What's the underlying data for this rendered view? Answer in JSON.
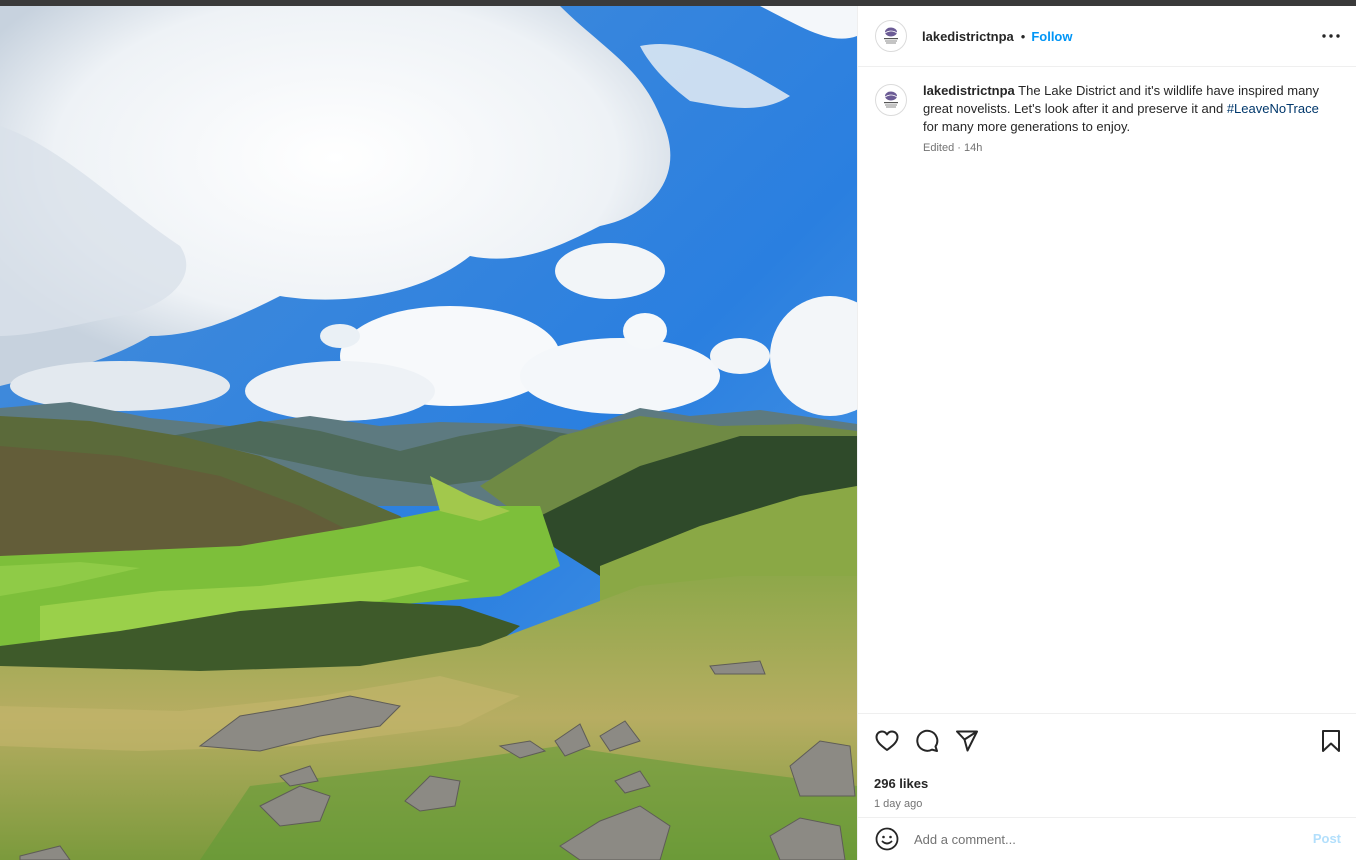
{
  "post": {
    "username": "lakedistrictnpa",
    "separator": "•",
    "follow_label": "Follow",
    "image_alt": "Mountain valley under a blue sky with clouds",
    "caption": {
      "username": "lakedistrictnpa",
      "text_before": " The Lake District and it's wildlife have inspired many great novelists. Let's look after it and preserve it and ",
      "hashtag": "#LeaveNoTrace",
      "text_after": " for many more generations to enjoy.",
      "meta": "Edited · 14h"
    },
    "likes": "296 likes",
    "posted": "1 day ago",
    "comment": {
      "placeholder": "Add a comment...",
      "post_label": "Post"
    },
    "icons": {
      "more": "more-options-icon",
      "like": "heart-icon",
      "comment": "comment-icon",
      "share": "share-icon",
      "save": "bookmark-icon",
      "emoji": "emoji-icon"
    },
    "colors": {
      "follow": "#0095f6",
      "post_disabled": "#b2dffc",
      "hashtag": "#00376b"
    }
  }
}
